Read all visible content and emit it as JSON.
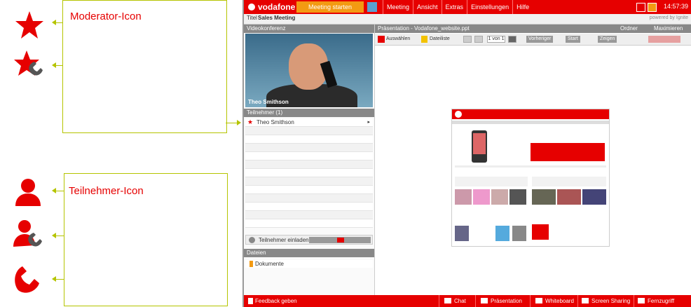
{
  "callouts": {
    "moderator_label": "Moderator-Icon",
    "participant_label": "Teilnehmer-Icon"
  },
  "icons": {
    "moderator": "star-icon",
    "moderator_phone": "star-phone-icon",
    "participant": "person-icon",
    "participant_phone": "person-phone-icon",
    "phone": "phone-handset-icon"
  },
  "colors": {
    "brand_red": "#e60000",
    "accent_lime": "#b5c400",
    "orange": "#f39a12"
  },
  "app": {
    "brand": "vodafone",
    "start_button": "Meeting starten",
    "menu": [
      "Meeting",
      "Ansicht",
      "Extras",
      "Einstellungen",
      "Hilfe"
    ],
    "clock": "14:57:39",
    "sub_tabs": [
      "Titel",
      "Sales Meeting"
    ],
    "powered_by": "powered by Ignite",
    "left": {
      "video_header": "Videokonferenz",
      "video_caption": "Theo Smithson",
      "participants_header": "Teilnehmer (1)",
      "participant_name": "Theo Smithson",
      "invite_label": "Teilnehmer einladen",
      "files_header": "Dateien",
      "file_name": "Dokumente"
    },
    "main": {
      "header_title": "Präsentation - Vodafone_website.ppt",
      "header_right_1": "Ordner",
      "header_right_2": "Maximieren",
      "toolbar": {
        "select": "Auswählen",
        "file": "Dateiliste",
        "page": "1 von 1",
        "prev": "Vorheriger",
        "start": "Start",
        "show": "Zeigen"
      }
    },
    "bottom": {
      "feedback": "Feedback geben",
      "items": [
        "Chat",
        "Präsentation",
        "Whiteboard",
        "Screen Sharing",
        "Fernzugriff"
      ]
    }
  }
}
